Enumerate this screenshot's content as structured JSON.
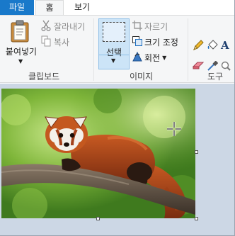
{
  "tabs": {
    "file": "파일",
    "home": "홈",
    "view": "보기"
  },
  "clipboard": {
    "paste": "붙여넣기",
    "cut": "잘라내기",
    "copy": "복사",
    "group_label": "클립보드"
  },
  "image": {
    "select": "선택",
    "crop": "자르기",
    "resize": "크기 조정",
    "rotate": "회전",
    "group_label": "이미지"
  },
  "tools": {
    "group_label": "도구"
  },
  "icons": {
    "paste": "clipboard-icon",
    "cut": "scissors-icon",
    "copy": "copy-icon",
    "select": "select-rectangle-icon",
    "crop": "crop-icon",
    "resize": "resize-icon",
    "rotate": "rotate-icon",
    "pencil": "pencil-icon",
    "fill": "fill-bucket-icon",
    "text": "text-icon",
    "eraser": "eraser-icon",
    "color_picker": "color-picker-icon",
    "magnifier": "magnifier-icon"
  },
  "colors": {
    "file_tab": "#1979ca",
    "ribbon": "#f5f6f7",
    "select_active": "#cce4f7",
    "workspace": "#ccd7e5"
  }
}
